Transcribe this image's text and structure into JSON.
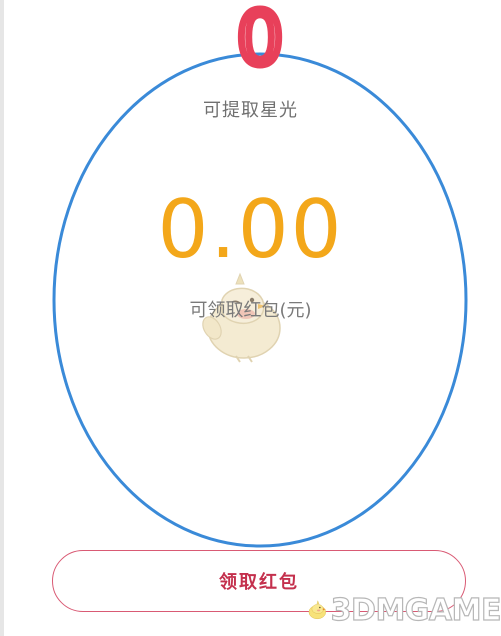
{
  "colors": {
    "accent_amount": "#f3a71a",
    "button_border": "#d95a74",
    "button_text": "#c4304d",
    "highlight_circle": "#3a8ad8",
    "highlight_marker": "#e8405a"
  },
  "starlight": {
    "label": "可提取星光"
  },
  "redpacket": {
    "amount": "0.00",
    "label": "可领取红包(元)"
  },
  "claim_button": {
    "label": "领取红包"
  },
  "watermark": {
    "text": "3DMGAME",
    "icon": "chick-mascot-icon"
  },
  "annotations": {
    "marker_value": "0"
  }
}
